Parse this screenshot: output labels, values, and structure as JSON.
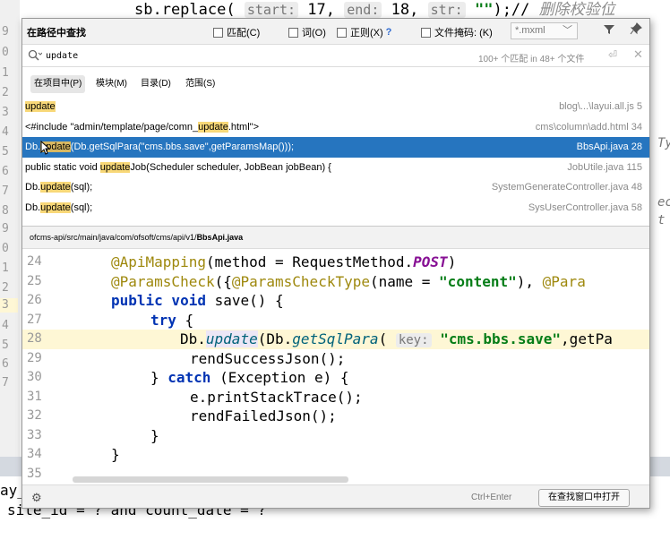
{
  "background": {
    "top_code": {
      "prefix": "sb.replace(",
      "hint_start": "start:",
      "val_start": "17,",
      "hint_end": "end:",
      "val_end": "18,",
      "hint_str": "str:",
      "val_str": "\"\"",
      "suffix": ");//",
      "comment": "删除校验位"
    },
    "line_numbers": [
      "9",
      "0",
      "1",
      "2",
      "3",
      "4",
      "5",
      "6",
      "7",
      "8",
      "9",
      "0",
      "1",
      "2",
      "3",
      "4",
      "5",
      "6",
      "7"
    ],
    "right_fragments": [
      "Ty",
      "ec",
      "t"
    ],
    "bottom_lines": [
      "ay_",
      "site_id = ? and count_date = ?"
    ]
  },
  "popup": {
    "title": "在路径中查找",
    "options": {
      "match_case": "匹配(C)",
      "words": "词(O)",
      "regex": "正则(X)",
      "regex_help": "?",
      "file_mask": "文件掩码: (K)"
    },
    "file_mask_value": "*.mxml",
    "search": {
      "value": "update",
      "match_count": "100+ 个匹配 in 48+ 个文件"
    },
    "scope_tabs": [
      "在项目中(P)",
      "模块(M)",
      "目录(D)",
      "范围(S)"
    ],
    "results": [
      {
        "pre": "",
        "match": "update",
        "post": "",
        "location": "blog\\...\\layui.all.js 5"
      },
      {
        "pre": "<#include \"admin/template/page/comn_",
        "match": "update",
        "post": ".html\">",
        "location": "cms\\column\\add.html 34"
      },
      {
        "pre": "Db.",
        "match": "update",
        "post": "(Db.getSqlPara(\"cms.bbs.save\",getParamsMap()));",
        "location": "BbsApi.java 28"
      },
      {
        "pre": "public static void ",
        "match": "update",
        "post": "Job(Scheduler scheduler, JobBean jobBean) {",
        "location": "JobUtile.java 115"
      },
      {
        "pre": "Db.",
        "match": "update",
        "post": "(sql);",
        "location": "SystemGenerateController.java 48"
      },
      {
        "pre": "Db.",
        "match": "update",
        "post": "(sql);",
        "location": "SysUserController.java 58"
      }
    ],
    "file_path_prefix": "ofcms-api/src/main/java/com/ofsoft/cms/api/v1/",
    "file_path_name": "BbsApi.java",
    "preview": {
      "line_numbers": [
        "24",
        "25",
        "26",
        "27",
        "28",
        "29",
        "30",
        "31",
        "32",
        "33",
        "34",
        "35"
      ],
      "current_line": "28",
      "l24": {
        "ann": "@ApiMapping",
        "a": "(method = RequestMethod.",
        "b": "POST",
        "c": ")"
      },
      "l25": {
        "ann": "@ParamsCheck",
        "a": "({",
        "ann2": "@ParamsCheckType",
        "b": "(name = ",
        "str": "\"content\"",
        "c": "), ",
        "ann3": "@Para"
      },
      "l26": {
        "kw": "public void",
        "a": " save() {"
      },
      "l27": {
        "kw": "try",
        "a": " {"
      },
      "l28": {
        "a": "Db.",
        "m1": "update",
        "b": "(Db.",
        "m2": "getSqlPara",
        "c": "( ",
        "hint": "key:",
        "str": "\"cms.bbs.save\"",
        "d": ",getPa"
      },
      "l29": {
        "a": "rendSuccessJson();"
      },
      "l30": {
        "a": "} ",
        "kw": "catch",
        "b": " (Exception e) {"
      },
      "l31": {
        "a": "e.printStackTrace();"
      },
      "l32": {
        "a": "rendFailedJson();"
      },
      "l33": {
        "a": "}"
      },
      "l34": {
        "a": "}"
      }
    },
    "footer": {
      "shortcut": "Ctrl+Enter",
      "open_button": "在查找窗口中打开"
    }
  }
}
